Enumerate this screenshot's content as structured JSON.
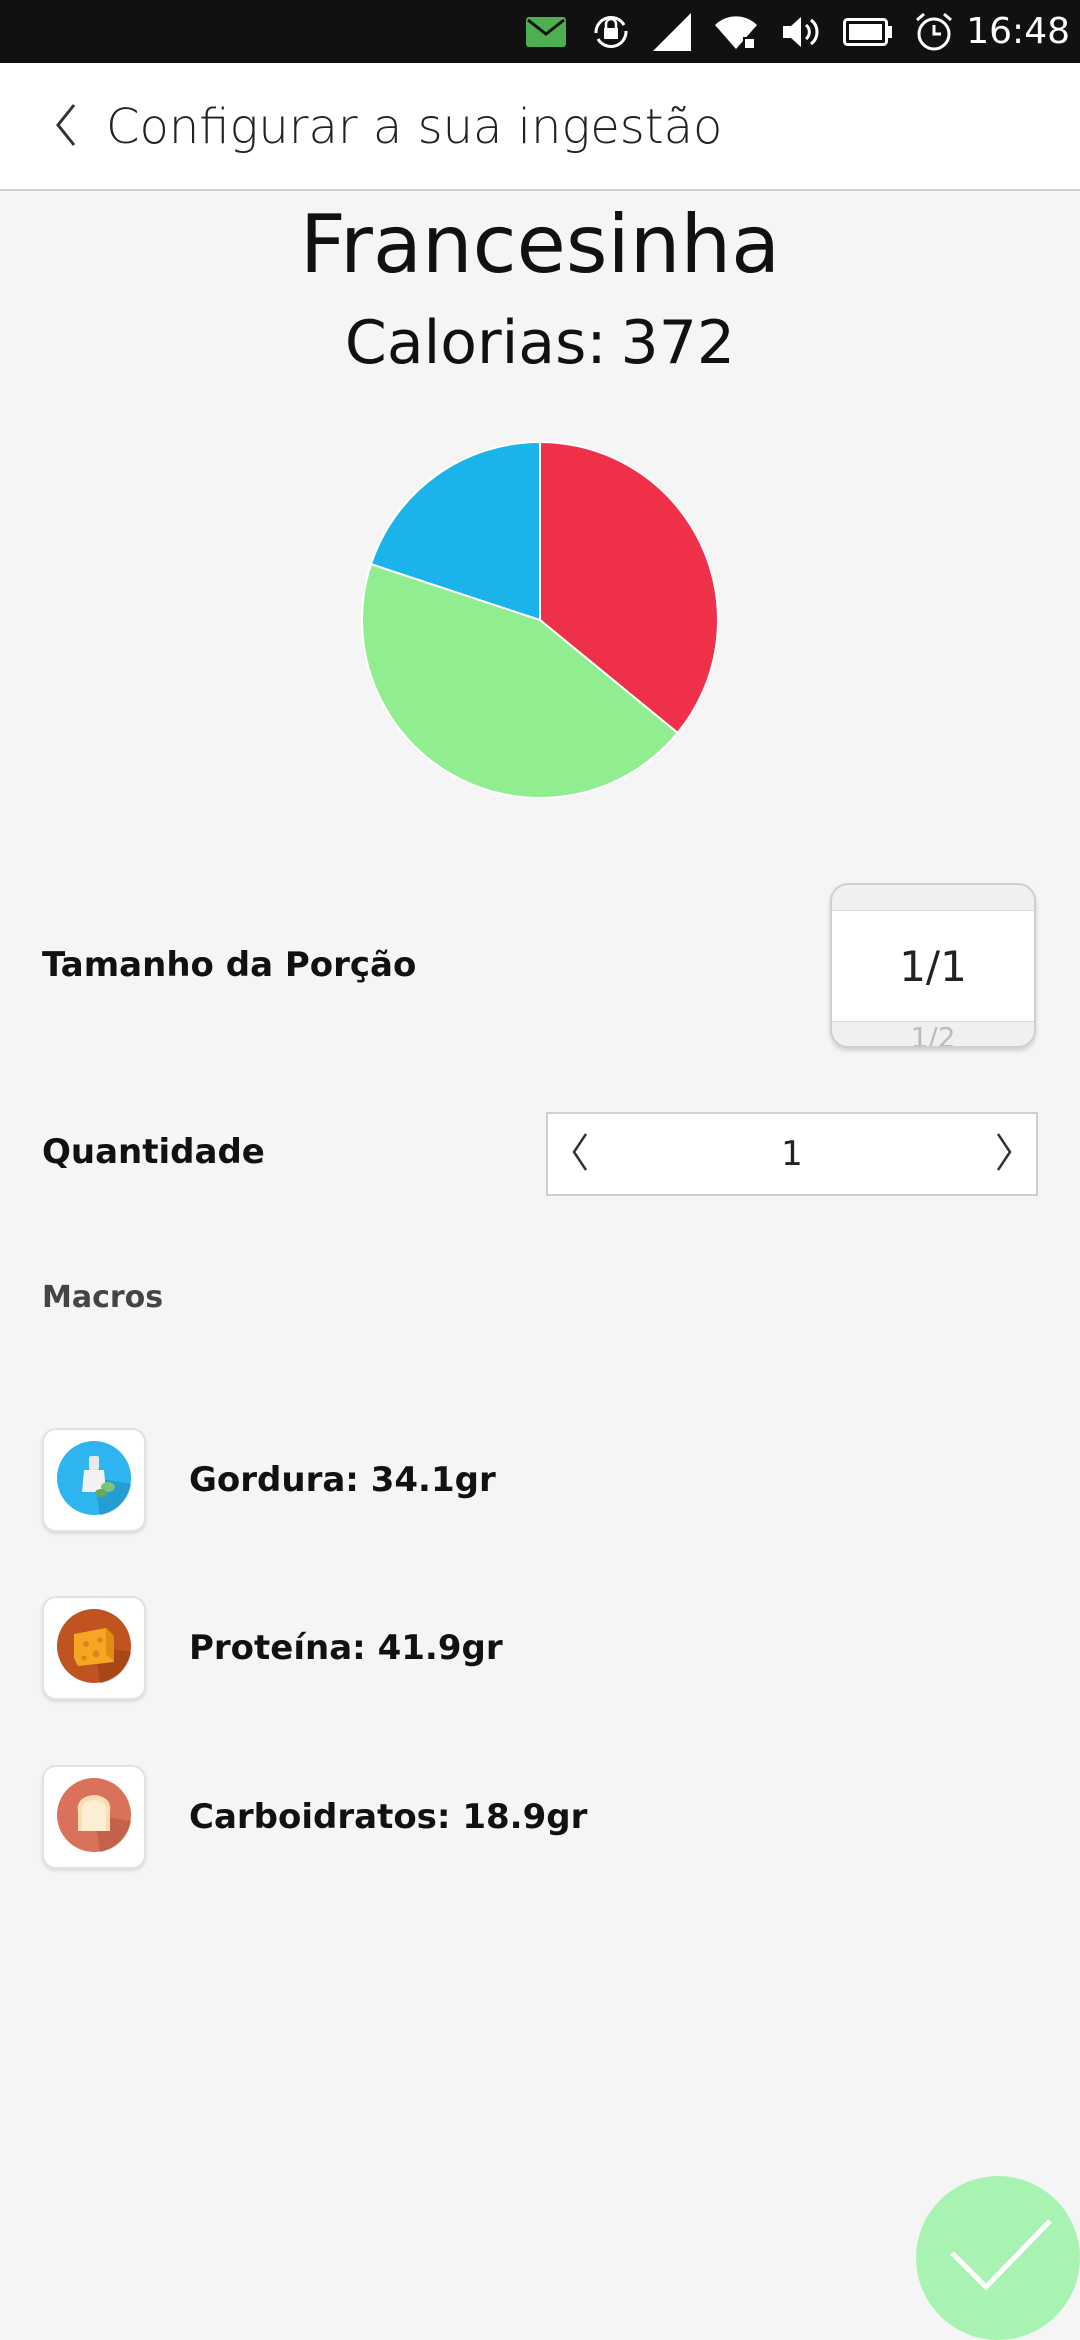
{
  "status_bar": {
    "time": "16:48",
    "icons": [
      "message-icon",
      "rotation-lock-icon",
      "signal-icon",
      "wifi-icon",
      "volume-icon",
      "battery-icon",
      "alarm-icon"
    ],
    "message_icon_color": "#4caf50"
  },
  "header": {
    "title": "Configurar a sua ingestão",
    "back_icon": "chevron-left-icon"
  },
  "food": {
    "name": "Francesinha",
    "calories_label": "Calorias:",
    "calories_value": "372"
  },
  "chart_data": {
    "type": "pie",
    "values": [
      34.1,
      41.9,
      18.9
    ],
    "colors": [
      "#ee3148",
      "#90ee90",
      "#1ab3ea"
    ],
    "start_angle_deg": 0,
    "direction": "clockwise"
  },
  "portion": {
    "label": "Tamanho da Porção",
    "selected": "1/1",
    "next_option": "1/2"
  },
  "quantity": {
    "label": "Quantidade",
    "value": "1",
    "decrement_icon": "chevron-left-icon",
    "increment_icon": "chevron-right-icon"
  },
  "macros": {
    "section_label": "Macros",
    "items": [
      {
        "label": "Gordura: 34.1gr",
        "icon": "fat-icon",
        "color": "#2eb4ee"
      },
      {
        "label": "Proteína: 41.9gr",
        "icon": "cheese-icon",
        "color": "#c0531f"
      },
      {
        "label": "Carboidratos: 18.9gr",
        "icon": "bread-icon",
        "color": "#d9715b"
      }
    ]
  },
  "fab": {
    "icon": "checkmark-icon",
    "color": "#a9f3b2"
  }
}
